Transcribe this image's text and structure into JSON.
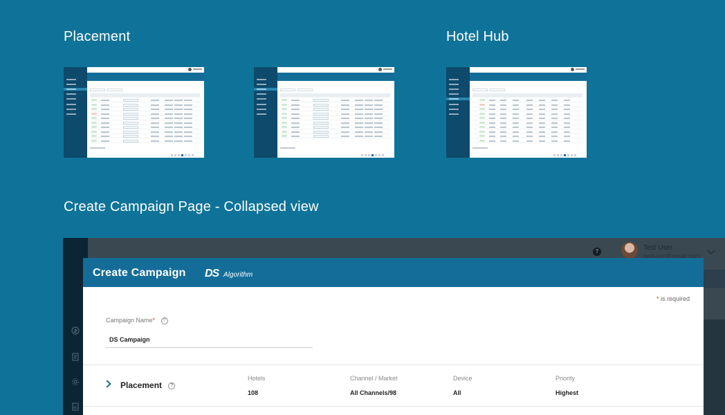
{
  "sections": {
    "placement_title": "Placement",
    "hotel_hub_title": "Hotel Hub",
    "campaign_title": "Create Campaign Page - Collapsed view"
  },
  "header": {
    "help_glyph": "?",
    "user_name": "Test User",
    "user_email": "testuser@email.com"
  },
  "modal": {
    "title": "Create Campaign",
    "logo_mark": "DS",
    "logo_sub": "Algorithm",
    "required_note": "is required",
    "required_star": "*"
  },
  "form": {
    "campaign_name_label": "Campaign Name",
    "campaign_name_value": "DS Campaign",
    "help_glyph": "?"
  },
  "placement": {
    "label": "Placement",
    "columns": [
      {
        "label": "Hotels",
        "value": "108"
      },
      {
        "label": "Channel / Market",
        "value": "All Channels/98"
      },
      {
        "label": "Device",
        "value": "All"
      },
      {
        "label": "Priority",
        "value": "Highest"
      }
    ]
  },
  "icons": {
    "sidebar": [
      "dollar-icon",
      "document-icon",
      "settings-icon",
      "report-icon"
    ]
  },
  "colors": {
    "background": "#0f7399",
    "brand": "#146d99",
    "sidebar": "#0b2535",
    "required": "#d23b2a"
  }
}
